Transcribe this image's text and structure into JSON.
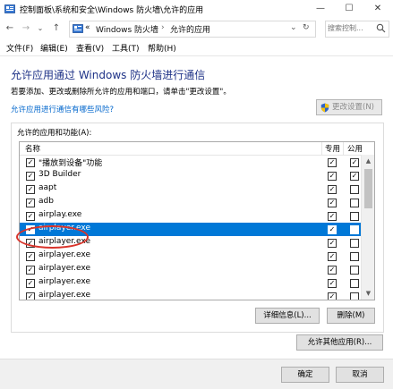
{
  "window": {
    "title": "控制面板\\系统和安全\\Windows 防火墙\\允许的应用",
    "minimize_glyph": "—",
    "maximize_glyph": "☐",
    "close_glyph": "✕"
  },
  "address": {
    "back_glyph": "←",
    "forward_glyph": "→",
    "dropdown_glyph": "⌄",
    "up_glyph": "↑",
    "prefix": "«",
    "crumbs": [
      "Windows 防火墙",
      "允许的应用"
    ],
    "separator": "›",
    "dropdown2_glyph": "⌄",
    "refresh_glyph": "↻",
    "search_placeholder": "搜索控制..."
  },
  "menu": [
    "文件(F)",
    "编辑(E)",
    "查看(V)",
    "工具(T)",
    "帮助(H)"
  ],
  "main": {
    "heading": "允许应用通过 Windows 防火墙进行通信",
    "subtext": "若要添加、更改或删除所允许的应用和端口，请单击\"更改设置\"。",
    "risk_link": "允许应用进行通信有哪些风险?",
    "change_settings": "更改设置(N)",
    "group_label": "允许的应用和功能(A):",
    "columns": {
      "name": "名称",
      "private": "专用",
      "public": "公用"
    },
    "rows": [
      {
        "name": "\"播放到设备\"功能",
        "enabled": true,
        "private": true,
        "public": true,
        "selected": false
      },
      {
        "name": "3D Builder",
        "enabled": true,
        "private": true,
        "public": true,
        "selected": false
      },
      {
        "name": "aapt",
        "enabled": true,
        "private": true,
        "public": false,
        "selected": false
      },
      {
        "name": "adb",
        "enabled": true,
        "private": true,
        "public": false,
        "selected": false
      },
      {
        "name": "airplay.exe",
        "enabled": true,
        "private": true,
        "public": false,
        "selected": false
      },
      {
        "name": "airplayer.exe",
        "enabled": true,
        "private": true,
        "public": false,
        "selected": true
      },
      {
        "name": "airplayer.exe",
        "enabled": true,
        "private": true,
        "public": false,
        "selected": false
      },
      {
        "name": "airplayer.exe",
        "enabled": true,
        "private": true,
        "public": false,
        "selected": false
      },
      {
        "name": "airplayer.exe",
        "enabled": true,
        "private": true,
        "public": false,
        "selected": false
      },
      {
        "name": "airplayer.exe",
        "enabled": true,
        "private": true,
        "public": false,
        "selected": false
      },
      {
        "name": "airplayer.exe",
        "enabled": true,
        "private": true,
        "public": false,
        "selected": false
      }
    ],
    "details_button": "详细信息(L)...",
    "delete_button": "删除(M)",
    "allow_other_button": "允许其他应用(R)..."
  },
  "footer": {
    "ok": "确定",
    "cancel": "取消"
  },
  "scroll_arrows": {
    "up": "▲",
    "down": "▼"
  },
  "colors": {
    "selection": "#0078d7",
    "heading": "#1e3287",
    "link": "#0066cc",
    "annotation_circle": "#d9342b"
  },
  "icons": [
    "control-panel-icon",
    "shield-icon",
    "search-icon",
    "refresh-icon"
  ]
}
